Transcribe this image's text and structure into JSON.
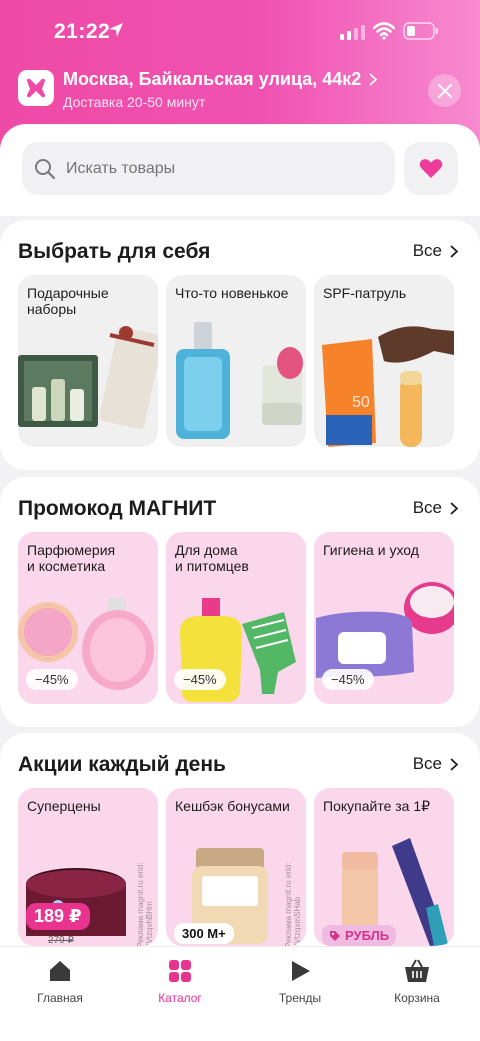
{
  "status_bar": {
    "time": "21:22"
  },
  "address": {
    "line": "Москва, Байкальская улица, 44к2",
    "delivery": "Доставка 20-50 минут"
  },
  "search": {
    "placeholder": "Искать товары"
  },
  "sections": [
    {
      "title": "Выбрать для себя",
      "all_label": "Все",
      "cards": [
        {
          "label": "Подарочные\nнаборы"
        },
        {
          "label": "Что-то новенькое"
        },
        {
          "label": "SPF-патруль"
        }
      ]
    },
    {
      "title": "Промокод МАГНИТ",
      "all_label": "Все",
      "cards": [
        {
          "label": "Парфюмерия\nи косметика",
          "discount": "−45%"
        },
        {
          "label": "Для дома\nи питомцев",
          "discount": "−45%"
        },
        {
          "label": "Гигиена и уход",
          "discount": "−45%"
        }
      ]
    },
    {
      "title": "Акции каждый день",
      "all_label": "Все",
      "cards": [
        {
          "label": "Суперцены",
          "price": "189 ₽",
          "old_price": "279 ₽",
          "ad": "Реклама magnit.ru erid: 2VtzqvhBHm"
        },
        {
          "label": "Кешбэк бонусами",
          "bonus": "300 М+",
          "ad": "Реклама magnit.ru erid: 2VtzqxmSHab"
        },
        {
          "label": "Покупайте за 1₽",
          "tag": "РУБЛЬ"
        }
      ]
    }
  ],
  "tabbar": [
    {
      "label": "Главная",
      "icon": "home-icon"
    },
    {
      "label": "Каталог",
      "icon": "catalog-icon",
      "active": true
    },
    {
      "label": "Тренды",
      "icon": "play-icon"
    },
    {
      "label": "Корзина",
      "icon": "basket-icon"
    }
  ],
  "colors": {
    "accent": "#e8338f",
    "header": "#ef4aa6"
  }
}
